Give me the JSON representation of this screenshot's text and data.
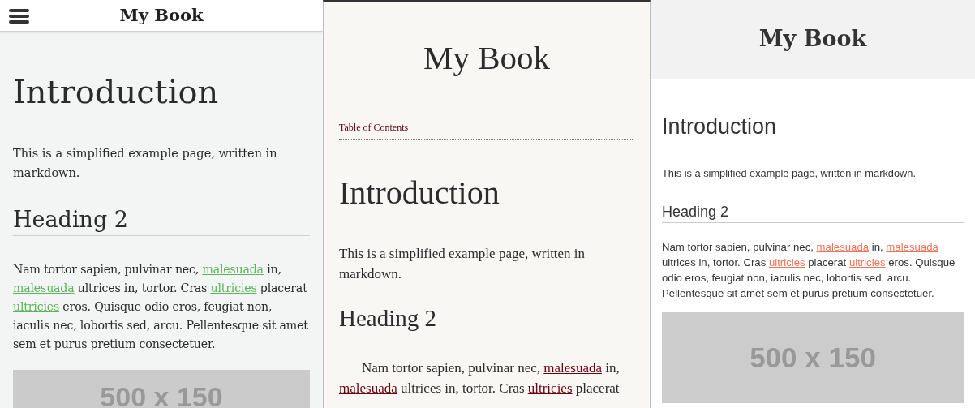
{
  "panels": [
    {
      "kind": "drawer",
      "title": "My Book",
      "heading": "Introduction",
      "intro": "This is a simplified example page, written in markdown.",
      "subheading": "Heading 2",
      "paragraph": [
        {
          "kind": "text",
          "text": "Nam tortor sapien, pulvinar nec, "
        },
        {
          "kind": "link",
          "text": "malesuada"
        },
        {
          "kind": "text",
          "text": " in, "
        },
        {
          "kind": "link",
          "text": "malesuada"
        },
        {
          "kind": "text",
          "text": " ultrices in, tortor. Cras "
        },
        {
          "kind": "link",
          "text": "ultricies"
        },
        {
          "kind": "text",
          "text": " placerat "
        },
        {
          "kind": "link",
          "text": "ultricies"
        },
        {
          "kind": "text",
          "text": " eros. Quisque odio eros, feugiat non, iaculis nec, lobortis sed, arcu. Pellentesque sit amet sem et purus pretium consectetuer."
        }
      ],
      "placeholder": "500 x 150"
    },
    {
      "kind": "paper",
      "title": "My Book",
      "toc_link": "Table of Contents",
      "heading": "Introduction",
      "intro": "This is a simplified example page, written in markdown.",
      "subheading": "Heading 2",
      "paragraph": [
        {
          "kind": "text",
          "text": "Nam tortor sapien, pulvinar nec, "
        },
        {
          "kind": "link",
          "text": "malesuada"
        },
        {
          "kind": "text",
          "text": " in, "
        },
        {
          "kind": "link",
          "text": "malesuada"
        },
        {
          "kind": "text",
          "text": " ultrices in, tortor. Cras "
        },
        {
          "kind": "link",
          "text": "ultricies"
        },
        {
          "kind": "text",
          "text": " placerat"
        }
      ]
    },
    {
      "kind": "flat",
      "title": "My Book",
      "heading": "Introduction",
      "intro": "This is a simplified example page, written in markdown.",
      "subheading": "Heading 2",
      "paragraph": [
        {
          "kind": "text",
          "text": "Nam tortor sapien, pulvinar nec, "
        },
        {
          "kind": "link",
          "text": "malesuada"
        },
        {
          "kind": "text",
          "text": " in, "
        },
        {
          "kind": "link",
          "text": "malesuada"
        },
        {
          "kind": "text",
          "text": " ultrices in, tortor. Cras "
        },
        {
          "kind": "link",
          "text": "ultricies"
        },
        {
          "kind": "text",
          "text": " placerat "
        },
        {
          "kind": "link",
          "text": "ultricies"
        },
        {
          "kind": "text",
          "text": " eros. Quisque odio eros, feugiat non, iaculis nec, lobortis sed, arcu. Pellentesque sit amet sem et purus pretium consectetuer."
        }
      ],
      "placeholder": "500 x 150"
    }
  ]
}
